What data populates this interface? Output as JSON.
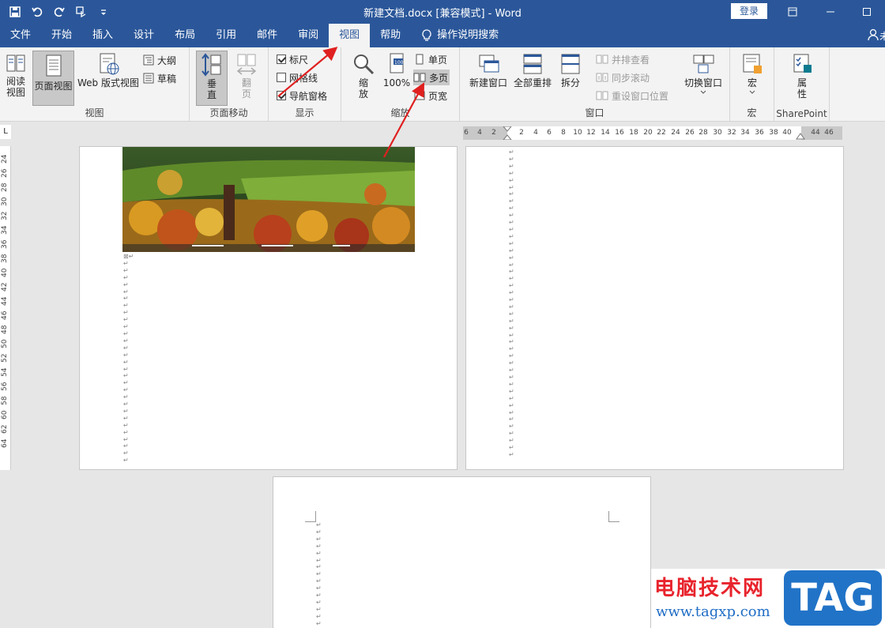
{
  "window": {
    "title": "新建文档.docx [兼容模式]  -  Word",
    "login_label": "登录"
  },
  "tabs": [
    {
      "label": "文件"
    },
    {
      "label": "开始"
    },
    {
      "label": "插入"
    },
    {
      "label": "设计"
    },
    {
      "label": "布局"
    },
    {
      "label": "引用"
    },
    {
      "label": "邮件"
    },
    {
      "label": "审阅"
    },
    {
      "label": "视图",
      "active": true
    },
    {
      "label": "帮助"
    }
  ],
  "search_label": "操作说明搜索",
  "share_glyph": "未",
  "ribbon": {
    "view": {
      "read": "阅读\n视图",
      "print": "页面视图",
      "web": "Web 版式视图",
      "outline": "大纲",
      "draft": "草稿",
      "label": "视图"
    },
    "pagemove": {
      "vertical": "垂\n直",
      "sidebyside": "翻\n页",
      "label": "页面移动"
    },
    "show": {
      "ruler": "标尺",
      "grid": "网格线",
      "nav": "导航窗格",
      "label": "显示"
    },
    "zoom": {
      "zoom": "缩\n放",
      "hundred": "100%",
      "one": "单页",
      "multi": "多页",
      "width": "页宽",
      "label": "缩放"
    },
    "window": {
      "new": "新建窗口",
      "arrange": "全部重排",
      "split": "拆分",
      "sbs": "并排查看",
      "sync": "同步滚动",
      "reset": "重设窗口位置",
      "switch": "切换窗口",
      "label": "窗口"
    },
    "macro": {
      "macros": "宏",
      "label": "宏"
    },
    "sharepoint": {
      "props": "属\n性",
      "label": "SharePoint"
    }
  },
  "hruler_ticks": [
    "6",
    "4",
    "2",
    "2",
    "4",
    "6",
    "8",
    "10",
    "12",
    "14",
    "16",
    "18",
    "20",
    "22",
    "24",
    "26",
    "28",
    "30",
    "32",
    "34",
    "36",
    "38",
    "40",
    "44",
    "46"
  ],
  "vruler_ticks": [
    "24",
    "26",
    "28",
    "30",
    "32",
    "34",
    "36",
    "38",
    "40",
    "42",
    "44",
    "46",
    "48",
    "50",
    "52",
    "54",
    "56",
    "58",
    "60",
    "62",
    "64"
  ],
  "ruler_corner": "L",
  "watermark": {
    "line1": "电脑技术网",
    "line2": "www.tagxp.com",
    "tag": "TAG"
  },
  "colors": {
    "word_blue": "#2b579a",
    "arrow_red": "#e02020"
  }
}
